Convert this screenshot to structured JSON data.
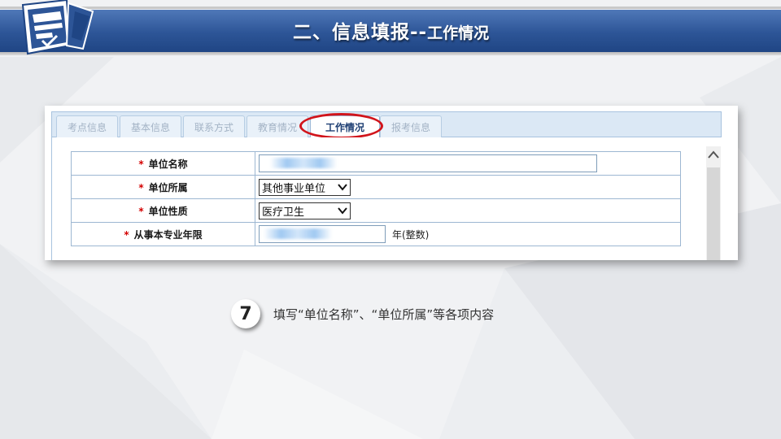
{
  "header": {
    "title_main": "二、信息填报--",
    "title_sub": "工作情况"
  },
  "tabs": [
    {
      "label": "考点信息",
      "active": false
    },
    {
      "label": "基本信息",
      "active": false
    },
    {
      "label": "联系方式",
      "active": false
    },
    {
      "label": "教育情况",
      "active": false
    },
    {
      "label": "工作情况",
      "active": true
    },
    {
      "label": "报考信息",
      "active": false
    }
  ],
  "form": {
    "required_mark": "*",
    "rows": {
      "unit_name": {
        "label": "单位名称",
        "value": ""
      },
      "unit_affiliation": {
        "label": "单位所属",
        "selected": "其他事业单位"
      },
      "unit_nature": {
        "label": "单位性质",
        "selected": "医疗卫生"
      },
      "years": {
        "label": "从事本专业年限",
        "value": "",
        "unit": "年(整数)"
      }
    }
  },
  "step": {
    "number": "7",
    "text": "填写“单位名称”、“单位所属”等各项内容"
  },
  "colors": {
    "header_blue": "#2d5597",
    "highlight_red": "#d1141b",
    "required_red": "#d40000"
  },
  "icons": {
    "logo": "certificate-book-icon",
    "scroll_up": "chevron-up-icon",
    "select_arrow": "chevron-down-icon"
  }
}
